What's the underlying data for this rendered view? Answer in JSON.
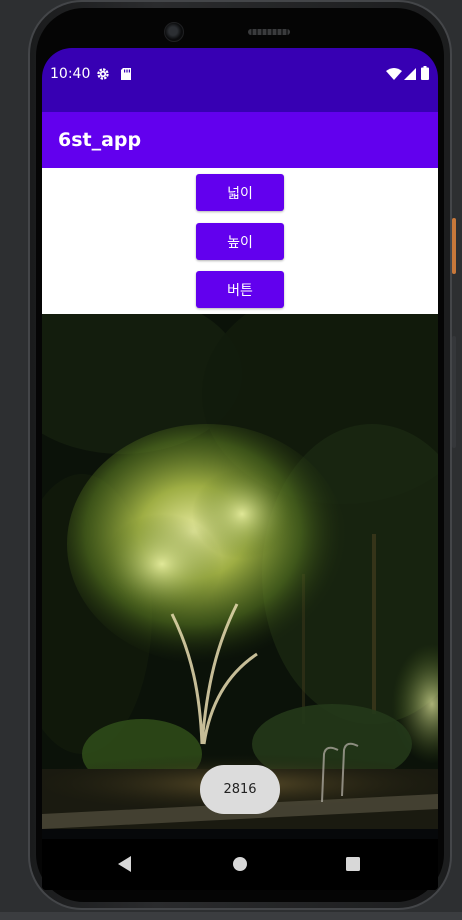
{
  "status_bar": {
    "time": "10:40",
    "left_icons": [
      "gear-icon",
      "sd-card-icon"
    ],
    "right_icons": [
      "wifi-icon",
      "signal-icon",
      "battery-icon"
    ],
    "color": "#3700b3"
  },
  "app_bar": {
    "title": "6st_app",
    "color": "#6200ee"
  },
  "buttons": [
    {
      "label": "넓이"
    },
    {
      "label": "높이"
    },
    {
      "label": "버튼"
    }
  ],
  "toast": {
    "text": "2816"
  },
  "image": {
    "description_icon": "night-tree-photo"
  },
  "nav_bar": {
    "icons": [
      "back-icon",
      "home-icon",
      "recents-icon"
    ]
  }
}
